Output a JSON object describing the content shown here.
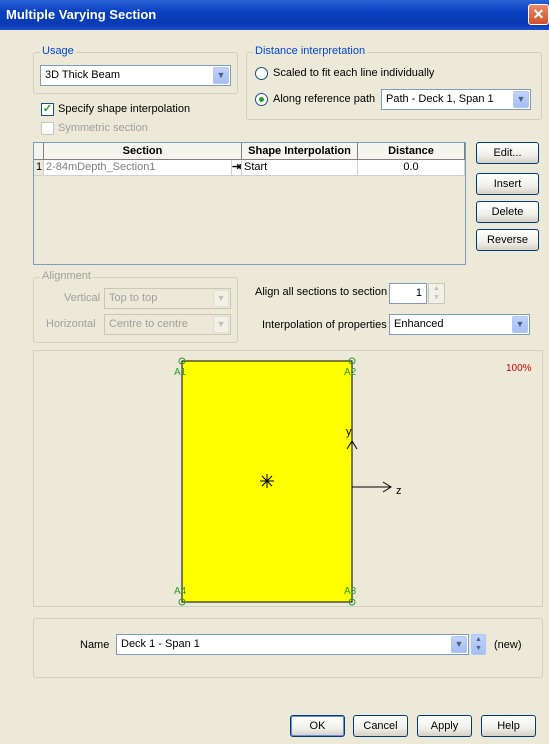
{
  "window": {
    "title": "Multiple Varying Section",
    "close_glyph": "✕"
  },
  "usage": {
    "group_label": "Usage",
    "selected": "3D Thick Beam",
    "specify_shape_interpolation": {
      "label": "Specify shape interpolation",
      "checked": true
    },
    "symmetric_section": {
      "label": "Symmetric section",
      "checked": false,
      "enabled": false
    }
  },
  "distance_interpretation": {
    "group_label": "Distance interpretation",
    "option_scaled": "Scaled to fit each line individually",
    "option_reference": "Along reference path",
    "selected_option": "reference",
    "path_selected": "Path - Deck 1, Span 1"
  },
  "sections_table": {
    "columns": [
      "Section",
      "Shape Interpolation",
      "Distance"
    ],
    "rows": [
      {
        "index": "1",
        "section": "2-84mDepth_Section1",
        "interpolation": "Start",
        "distance": "0.0"
      }
    ]
  },
  "side_buttons": {
    "edit": "Edit...",
    "insert": "Insert",
    "delete": "Delete",
    "reverse": "Reverse"
  },
  "alignment": {
    "group_label": "Alignment",
    "vertical_label": "Vertical",
    "vertical_value": "Top to top",
    "horizontal_label": "Horizontal",
    "horizontal_value": "Centre to centre"
  },
  "align_all": {
    "label": "Align all sections to section",
    "value": "1"
  },
  "interpolation_properties": {
    "label": "Interpolation of properties",
    "value": "Enhanced"
  },
  "preview": {
    "zoom": "100%",
    "corner_labels": [
      "A1",
      "A2",
      "A3",
      "A4"
    ],
    "axis_y": "y",
    "axis_z": "z",
    "fill_color": "#ffff00",
    "vertex_color": "#2e9a2e",
    "zoom_color": "#cc0000"
  },
  "name": {
    "label": "Name",
    "value": "Deck 1 - Span 1",
    "status": "(new)"
  },
  "footer": {
    "ok": "OK",
    "cancel": "Cancel",
    "apply": "Apply",
    "help": "Help"
  }
}
